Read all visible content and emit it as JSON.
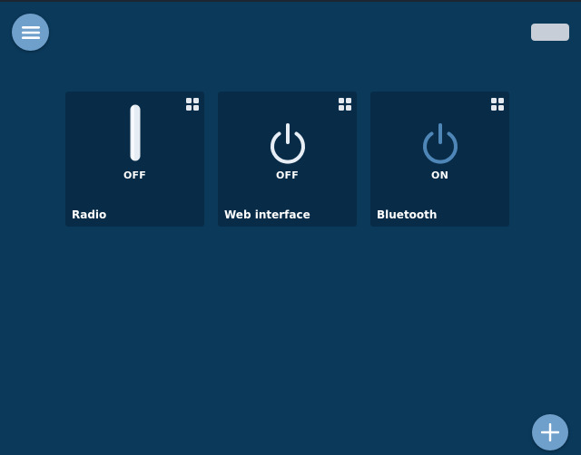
{
  "header": {
    "menu_icon": "hamburger-menu-icon",
    "action_icon": "pill-button"
  },
  "tiles": [
    {
      "label": "Radio",
      "state": "OFF",
      "control_icon": "toggle-bar-icon",
      "settings_icon": "grid-icon"
    },
    {
      "label": "Web interface",
      "state": "OFF",
      "control_icon": "power-icon",
      "settings_icon": "grid-icon",
      "color": "#e8eef6"
    },
    {
      "label": "Bluetooth",
      "state": "ON",
      "control_icon": "power-icon",
      "settings_icon": "grid-icon",
      "color": "#4f86b8"
    }
  ],
  "fab": {
    "icon": "plus-icon"
  },
  "colors": {
    "background": "#0b395a",
    "tile": "#082c47",
    "accent": "#6f9fcb"
  }
}
